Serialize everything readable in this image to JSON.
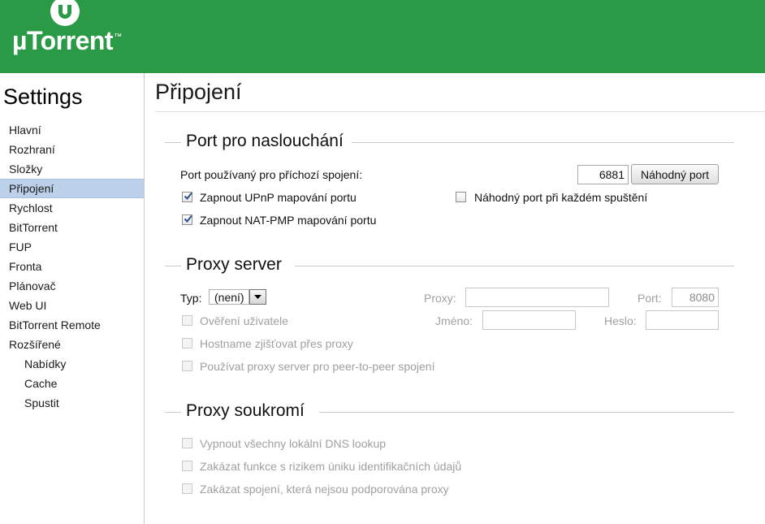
{
  "header": {
    "logo_text": "µTorrent",
    "logo_tm": "™",
    "brand_color": "#2b9a47"
  },
  "sidebar": {
    "title": "Settings",
    "items": [
      {
        "label": "Hlavní"
      },
      {
        "label": "Rozhraní"
      },
      {
        "label": "Složky"
      },
      {
        "label": "Připojení",
        "active": true
      },
      {
        "label": "Rychlost"
      },
      {
        "label": "BitTorrent"
      },
      {
        "label": "FUP"
      },
      {
        "label": "Fronta"
      },
      {
        "label": "Plánovač"
      },
      {
        "label": "Web UI"
      },
      {
        "label": "BitTorrent Remote"
      },
      {
        "label": "Rozšířené"
      },
      {
        "label": "Nabídky",
        "sub": true
      },
      {
        "label": "Cache",
        "sub": true
      },
      {
        "label": "Spustit",
        "sub": true
      }
    ]
  },
  "main": {
    "title": "Připojení",
    "listen": {
      "heading": "Port pro naslouchání",
      "port_label": "Port používaný pro příchozí spojení:",
      "port_value": "6881",
      "random_port_button": "Náhodný port",
      "upnp_label": "Zapnout UPnP mapování portu",
      "upnp_checked": true,
      "natpmp_label": "Zapnout NAT-PMP mapování portu",
      "natpmp_checked": true,
      "random_each_start_label": "Náhodný port při každém spuštění",
      "random_each_start_checked": false
    },
    "proxy": {
      "heading": "Proxy server",
      "type_label": "Typ:",
      "type_value": "(není)",
      "proxy_label": "Proxy:",
      "proxy_value": "",
      "port_label": "Port:",
      "port_value": "8080",
      "auth_label": "Ověření uživatele",
      "name_label": "Jméno:",
      "name_value": "",
      "password_label": "Heslo:",
      "password_value": "",
      "hostname_label": "Hostname zjišťovat přes proxy",
      "p2p_label": "Používat proxy server pro peer-to-peer spojení"
    },
    "privacy": {
      "heading": "Proxy soukromí",
      "dns_label": "Vypnout všechny lokální DNS lookup",
      "leak_label": "Zakázat funkce s rizikem úniku identifikačních údajů",
      "unsupported_label": "Zakázat spojení, která nejsou podporována proxy"
    }
  }
}
